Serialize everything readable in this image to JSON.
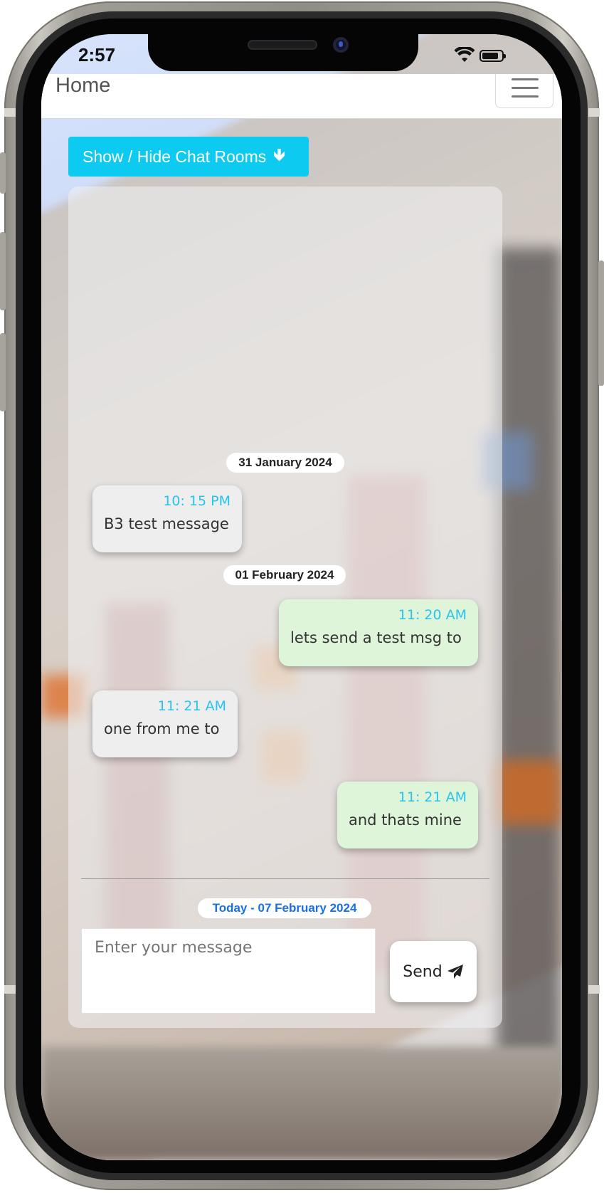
{
  "status_bar": {
    "time": "2:57"
  },
  "navbar": {
    "title": "Home",
    "menu_icon": "hamburger-menu-icon"
  },
  "chat": {
    "rooms_button": {
      "label": "Show / Hide Chat Rooms",
      "icon": "arrow-down-icon"
    },
    "date_separators": [
      "31 January 2024",
      "01 February 2024"
    ],
    "messages": [
      {
        "time": "10: 15 PM",
        "text": "B3 test message",
        "sender": "them"
      },
      {
        "time": "11: 20 AM",
        "text": "lets send a test msg to",
        "sender": "me"
      },
      {
        "time": "11: 21 AM",
        "text": "one from me to",
        "sender": "them"
      },
      {
        "time": "11: 21 AM",
        "text": "and thats mine",
        "sender": "me"
      }
    ],
    "today_label": "Today - 07 February 2024",
    "input": {
      "placeholder": "Enter your message",
      "value": ""
    },
    "send_button": {
      "label": "Send",
      "icon": "paper-plane-icon"
    }
  },
  "colors": {
    "accent": "#0dcaf0",
    "time_text": "#27c3ef",
    "today_text": "#1a6fe8",
    "incoming_bubble": "#eeeeee",
    "outgoing_bubble": "#dff5da"
  }
}
